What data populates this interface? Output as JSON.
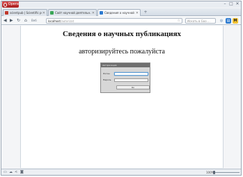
{
  "browser": {
    "menu_label": "Opera",
    "window_controls": [
      "–",
      "□",
      "✕"
    ],
    "tabs": [
      {
        "label": "scientpub | Scientific pu...",
        "close": "✕",
        "favicon_color": "#c0392b"
      },
      {
        "label": "Сайт научной деятельн...",
        "close": "✕",
        "favicon_color": "#3aa655"
      },
      {
        "label": "Сведения о научной ра...",
        "close": "✕",
        "favicon_color": "#2d7bd1"
      }
    ],
    "new_tab": "+",
    "nav": {
      "back": "◀",
      "forward": "▶",
      "reload": "↻",
      "home": "⌂",
      "speed_dial": "Веб"
    },
    "address": {
      "host": "localhost",
      "path": "/autorizat"
    },
    "address_star": "☆",
    "search_placeholder": "Искать в Goo ...",
    "right_buttons": [
      "◎",
      "▤",
      "M"
    ]
  },
  "page": {
    "title": "Сведения о научных публикациях",
    "subtitle": "авторизируйтесь пожалуйста"
  },
  "login": {
    "header": "Авторизация",
    "login_label": "Логин",
    "password_label": "Пароль",
    "submit": "Ок"
  },
  "statusbar": {
    "icons": [
      "panel-icon",
      "cloud-icon",
      "share-icon",
      "camera-icon"
    ],
    "zoom": "100%",
    "zoom_level": 0.0
  }
}
